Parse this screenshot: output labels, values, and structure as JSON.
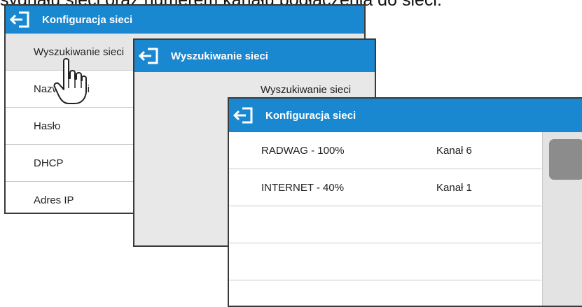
{
  "caption": "sygnału sieci oraz numerem kanału podłączenia do sieci.",
  "window_network_config": {
    "title": "Konfiguracja sieci",
    "items": [
      {
        "label": "Wyszukiwanie sieci"
      },
      {
        "label": "Nazwa sieci"
      },
      {
        "label": "Hasło"
      },
      {
        "label": "DHCP"
      },
      {
        "label": "Adres IP"
      }
    ]
  },
  "window_network_search": {
    "title": "Wyszukiwanie sieci",
    "row_label": "Wyszukiwanie sieci"
  },
  "window_network_results": {
    "title": "Konfiguracja sieci",
    "networks": [
      {
        "ssid": "RADWAG - 100%",
        "channel": "Kanał 6"
      },
      {
        "ssid": "INTERNET - 40%",
        "channel": "Kanał 1"
      }
    ]
  },
  "icons": {
    "back": "exit-arrow-icon",
    "pointer": "hand-pointer-icon"
  },
  "colors": {
    "titlebar": "#1a87d1",
    "scroll_thumb": "#8c8c8c"
  }
}
